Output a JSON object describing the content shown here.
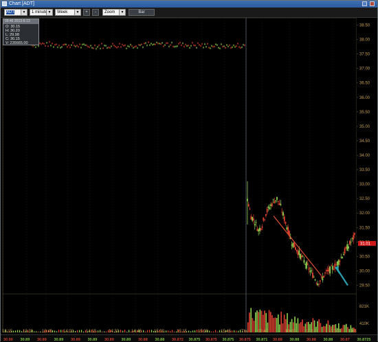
{
  "window": {
    "title": "Chart [ADT]"
  },
  "toolbar": {
    "symbol": "ADT",
    "interval": "1 minute",
    "range": "Week",
    "zoom_in_label": "+",
    "zoom_out_label": "-",
    "zoom_label": "Zoom",
    "bar_label": "Bar"
  },
  "info": {
    "header": "09:46 2013-6-13",
    "open": "O: 30.15",
    "high": "H: 30.20",
    "low": "L: 29.98",
    "close": "C: 30.15",
    "volume": "V: 235665.00"
  },
  "price_axis": [
    "38.50",
    "38.00",
    "37.50",
    "37.00",
    "36.50",
    "36.00",
    "35.50",
    "35.00",
    "34.50",
    "34.00",
    "33.50",
    "33.00",
    "32.50",
    "32.00",
    "31.50",
    "31.00",
    "30.50",
    "30.00",
    "29.50"
  ],
  "last_price_tag": "31.01",
  "volume_axis": [
    "821K",
    "410K"
  ],
  "time_axis": [
    "13:15",
    "13:30",
    "13:45",
    "14:00",
    "14:15",
    "14:30",
    "14:45",
    "15:00",
    "15:15",
    "15:30",
    "15:45",
    "Thu",
    "09:45",
    "10:00",
    "10:15",
    "10:30",
    "10:45"
  ],
  "bottom_values": [
    "30.90",
    "30.89",
    "30.89",
    "30.89",
    "30.89",
    "30.89",
    "30.89",
    "30.89",
    "30.88",
    "30.88",
    "30.872",
    "30.875",
    "30.875",
    "30.875",
    "30.875",
    "30.871",
    "30.88",
    "30.88",
    "30.88",
    "30.88",
    "30.87",
    "30.8725"
  ],
  "colors": {
    "up": "#8fd14f",
    "down": "#e04030",
    "trend": "#e05030",
    "arrow": "#2aa0b0",
    "axis_text": "#c8a050"
  },
  "chart_data": {
    "type": "candlestick",
    "prev_session": {
      "price_level": 37.8,
      "range": [
        37.7,
        37.9
      ]
    },
    "session_close_series": [
      32.5,
      31.9,
      31.7,
      31.4,
      31.6,
      32.0,
      32.2,
      32.4,
      32.5,
      32.2,
      31.8,
      31.4,
      31.0,
      30.8,
      30.6,
      30.4,
      30.2,
      30.0,
      29.8,
      29.6,
      29.7,
      29.9,
      30.0,
      30.1,
      30.2,
      30.4,
      30.6,
      30.8,
      31.0,
      31.2
    ],
    "ylim": [
      29.25,
      38.75
    ]
  }
}
